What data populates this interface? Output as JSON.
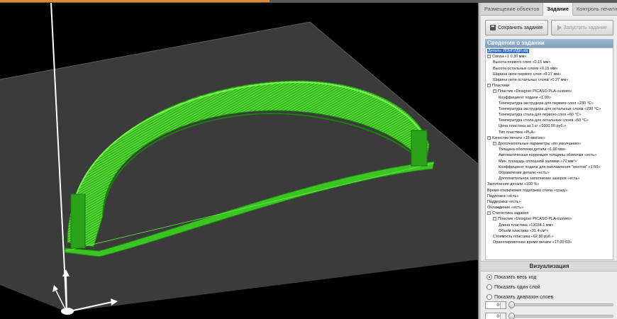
{
  "tabs": [
    "Размещение объектов",
    "Задание",
    "Контроль печати"
  ],
  "active_tab": 1,
  "buttons": {
    "save": "Сохранить задание",
    "run": "Запустить задание"
  },
  "info_title": "Сведения о задании",
  "tree": [
    {
      "level": 0,
      "toggle": "",
      "text": "Деталь: ЛОНГИДИ.obj",
      "selected": true
    },
    {
      "level": 0,
      "toggle": "−",
      "text": "Сопла «1 0.30 мм»"
    },
    {
      "level": 1,
      "toggle": "",
      "text": "Высота первого слоя «0.15 мм»"
    },
    {
      "level": 1,
      "toggle": "",
      "text": "Высота остальных слоев «0.15 мм»"
    },
    {
      "level": 1,
      "toggle": "",
      "text": "Ширина нити первого слоя «0.27 мм»"
    },
    {
      "level": 1,
      "toggle": "",
      "text": "Ширина нити остальных слоев «0.27 мм»"
    },
    {
      "level": 0,
      "toggle": "−",
      "text": "Пластики"
    },
    {
      "level": 1,
      "toggle": "−",
      "text": "Пластик «Designer PICASO PLA-custom»"
    },
    {
      "level": 2,
      "toggle": "",
      "text": "Коэффициент подачи «1.00»"
    },
    {
      "level": 2,
      "toggle": "",
      "text": "Температура экструдера для первого слоя «230 °C»"
    },
    {
      "level": 2,
      "toggle": "",
      "text": "Температура экструдера для остальных слоев «230 °C»"
    },
    {
      "level": 2,
      "toggle": "",
      "text": "Температура стола для первого слоя «60 °C»"
    },
    {
      "level": 2,
      "toggle": "",
      "text": "Температура стола для остальных слоев «50 °C»"
    },
    {
      "level": 2,
      "toggle": "",
      "text": "Цена пластика за 1 кг «1600.00 руб.»"
    },
    {
      "level": 2,
      "toggle": "",
      "text": "Тип пластика «PLA»"
    },
    {
      "level": 0,
      "toggle": "−",
      "text": "Качество печати «15 мм/сек»"
    },
    {
      "level": 1,
      "toggle": "−",
      "text": "Дополнительные параметры «по умолчанию»"
    },
    {
      "level": 2,
      "toggle": "",
      "text": "Толщина оболочки детали «1.00 мм»"
    },
    {
      "level": 2,
      "toggle": "",
      "text": "Автоматическая коррекция толщины оболочки «есть»"
    },
    {
      "level": 2,
      "toggle": "",
      "text": "Мин. площадь сплошной заливки «70 мм²»"
    },
    {
      "level": 2,
      "toggle": "",
      "text": "Коэффициент подачи для наплавления \"мостов\" «1.50»"
    },
    {
      "level": 2,
      "toggle": "",
      "text": "Обрамление детали «есть»"
    },
    {
      "level": 2,
      "toggle": "",
      "text": "Дополнительное заполнение зазоров «есть»"
    },
    {
      "level": 0,
      "toggle": "",
      "text": "Заполнение детали «100 %»"
    },
    {
      "level": 0,
      "toggle": "",
      "text": "Время отключения подогрева стола «сразу»"
    },
    {
      "level": 0,
      "toggle": "",
      "text": "Подложка «есть»"
    },
    {
      "level": 0,
      "toggle": "",
      "text": "Поддержка «есть»"
    },
    {
      "level": 0,
      "toggle": "",
      "text": "Охлаждение «есть»"
    },
    {
      "level": 0,
      "toggle": "−",
      "text": "Статистика задания"
    },
    {
      "level": 1,
      "toggle": "−",
      "text": "Пластик «Designer PICASO PLA-custom»"
    },
    {
      "level": 2,
      "toggle": "",
      "text": "Длина пластика «13034.1 мм»"
    },
    {
      "level": 2,
      "toggle": "",
      "text": "Объем пластика «31.4 см³»"
    },
    {
      "level": 1,
      "toggle": "",
      "text": "Стоимость пластика «62.80 руб.»"
    },
    {
      "level": 1,
      "toggle": "",
      "text": "Ориентировочное время печати «17:00:03»"
    }
  ],
  "visualization": {
    "title": "Визуализация",
    "options": [
      "Показать весь код",
      "Показать один слой",
      "Показать диапазон слоев"
    ],
    "selected": 0,
    "spin1": "0",
    "spin2": "0"
  },
  "colors": {
    "model": "#39c41f",
    "bed": "#3c3c3c",
    "background": "#000000"
  }
}
